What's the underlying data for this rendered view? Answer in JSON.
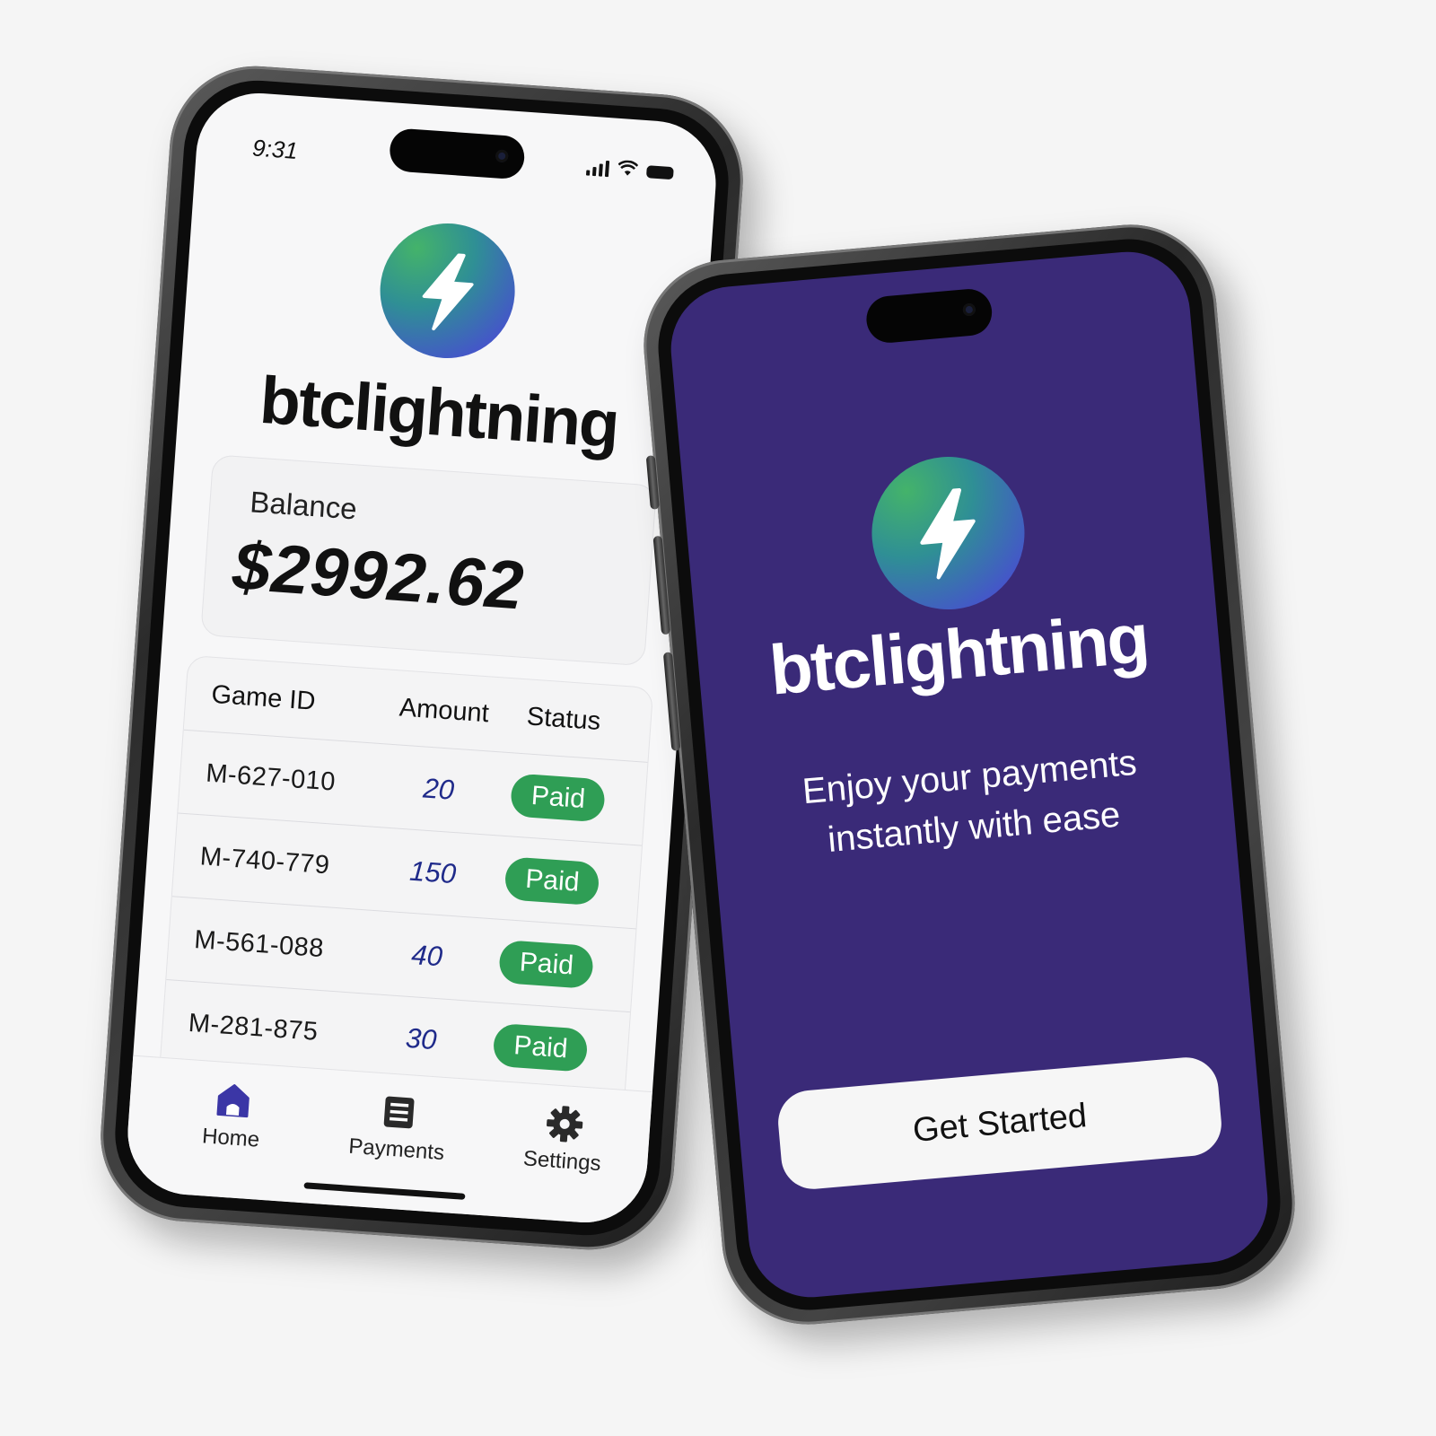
{
  "colors": {
    "background": "#f5f5f5",
    "dark_screen": "#3a2a78",
    "accent_navy": "#1f2a8a",
    "paid_green": "#2f9e55",
    "logo_gradient": [
      "#44b36a",
      "#2f8f95",
      "#4457c8",
      "#5a55d6"
    ]
  },
  "left_phone": {
    "status_bar": {
      "time": "9:31",
      "icons": [
        "signal-icon",
        "wifi-icon",
        "battery-icon"
      ]
    },
    "logo_icon": "lightning-bolt-icon",
    "brand": "btclightning",
    "balance": {
      "label": "Balance",
      "amount": "$2992.62"
    },
    "transactions": {
      "headers": [
        "Game ID",
        "Amount",
        "Status"
      ],
      "rows": [
        {
          "id": "M-627-010",
          "amount": "20",
          "status": "Paid"
        },
        {
          "id": "M-740-779",
          "amount": "150",
          "status": "Paid"
        },
        {
          "id": "M-561-088",
          "amount": "40",
          "status": "Paid"
        },
        {
          "id": "M-281-875",
          "amount": "30",
          "status": "Paid"
        }
      ]
    },
    "tabs": [
      {
        "label": "Home",
        "icon": "home-icon",
        "active": true
      },
      {
        "label": "Payments",
        "icon": "list-icon",
        "active": false
      },
      {
        "label": "Settings",
        "icon": "gear-icon",
        "active": false
      }
    ]
  },
  "right_phone": {
    "logo_icon": "lightning-bolt-icon",
    "brand": "btclightning",
    "tagline_line1": "Enjoy your payments",
    "tagline_line2": "instantly with ease",
    "cta_label": "Get Started"
  }
}
